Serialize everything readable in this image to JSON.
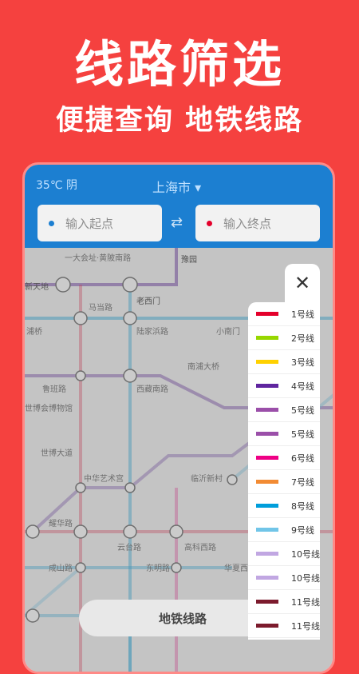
{
  "promo": {
    "title": "线路筛选",
    "subtitle": "便捷查询 地铁线路"
  },
  "header": {
    "weather": "35℃ 阴",
    "city": "上海市",
    "city_arrow": "▾"
  },
  "search": {
    "start_placeholder": "输入起点",
    "end_placeholder": "输入终点",
    "swap_symbol": "⇄"
  },
  "map_labels": [
    {
      "id": "xintiandi",
      "text": "新天地"
    },
    {
      "id": "laoximen",
      "text": "老西门"
    },
    {
      "id": "yuyuan",
      "text": "豫园"
    },
    {
      "id": "madang",
      "text": "马当路"
    },
    {
      "id": "luban",
      "text": "陆家浜路"
    },
    {
      "id": "xiaonanmen",
      "text": "小南门"
    },
    {
      "id": "puxi",
      "text": "浦桥"
    },
    {
      "id": "nanpudaqiao",
      "text": "南浦大桥"
    },
    {
      "id": "xizang",
      "text": "西藏南路"
    },
    {
      "id": "luban2",
      "text": "鲁班路"
    },
    {
      "id": "museum",
      "text": "世博会博物馆"
    },
    {
      "id": "shibodadao",
      "text": "世博大道"
    },
    {
      "id": "art",
      "text": "中华艺术宫"
    },
    {
      "id": "linyi",
      "text": "临沂新村"
    },
    {
      "id": "yaohua",
      "text": "耀华路"
    },
    {
      "id": "yuntai",
      "text": "云台路"
    },
    {
      "id": "gaoke",
      "text": "高科西路"
    },
    {
      "id": "chengshan",
      "text": "成山路"
    },
    {
      "id": "dongming",
      "text": "东明路"
    },
    {
      "id": "huaxia",
      "text": "华夏西路"
    },
    {
      "id": "dashijie",
      "text": "一大会址·黄陂南路"
    }
  ],
  "bottom_button": "地铁线路",
  "close_symbol": "✕",
  "lines": [
    {
      "label": "1号线",
      "color": "#e4002b"
    },
    {
      "label": "2号线",
      "color": "#97d700"
    },
    {
      "label": "3号线",
      "color": "#ffd100"
    },
    {
      "label": "4号线",
      "color": "#5f259f"
    },
    {
      "label": "5号线",
      "color": "#9b4fa9"
    },
    {
      "label": "5号线",
      "color": "#9b4fa9"
    },
    {
      "label": "6号线",
      "color": "#ef0085"
    },
    {
      "label": "7号线",
      "color": "#f28b33"
    },
    {
      "label": "8号线",
      "color": "#009edb"
    },
    {
      "label": "9号线",
      "color": "#71c5e8"
    },
    {
      "label": "10号线",
      "color": "#c1a7e2"
    },
    {
      "label": "10号线",
      "color": "#c1a7e2"
    },
    {
      "label": "11号线",
      "color": "#7c1b2d"
    },
    {
      "label": "11号线",
      "color": "#7c1b2d"
    }
  ]
}
